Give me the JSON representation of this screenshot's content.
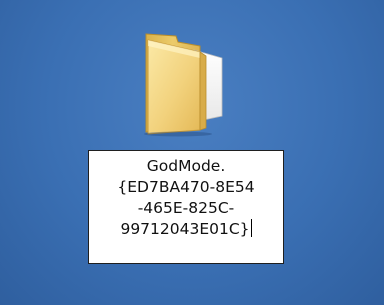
{
  "desktop": {
    "background_color": "#3a6fb3",
    "folder_icon": {
      "icon": "folder-icon",
      "rename_field": {
        "value_lines": [
          "GodMode.",
          "{ED7BA470-8E54",
          "-465E-825C-",
          "99712043E01C}"
        ]
      }
    }
  }
}
